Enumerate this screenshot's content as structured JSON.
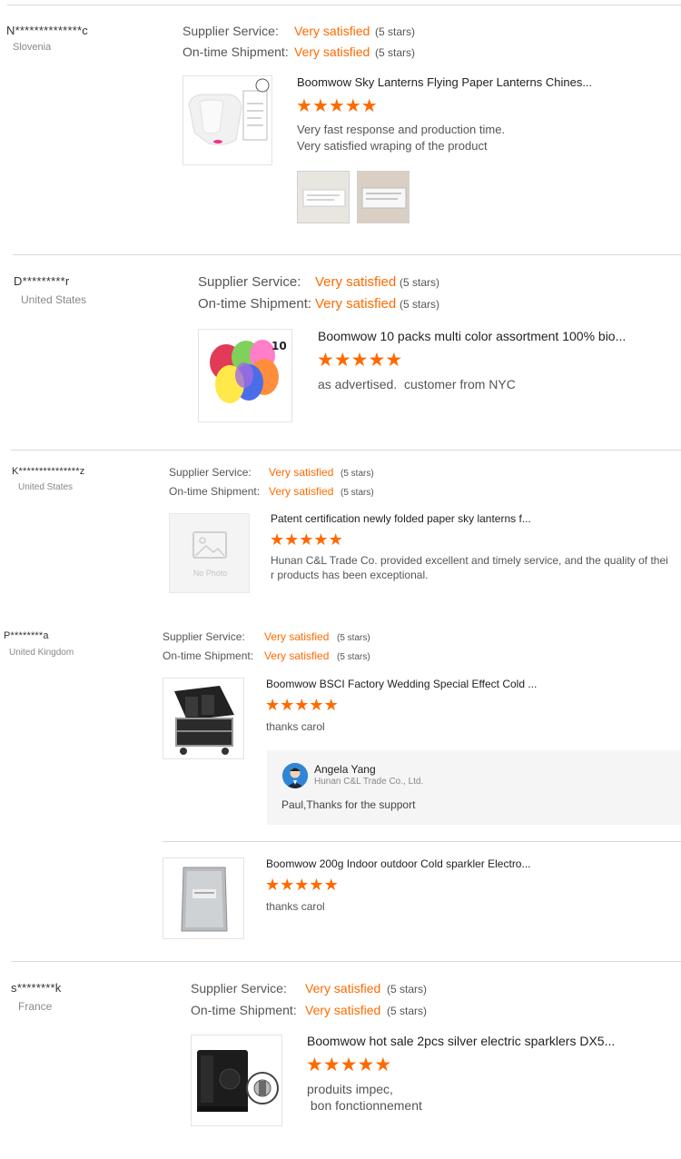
{
  "labels": {
    "supplier_service": "Supplier Service:",
    "ontime_shipment": "On-time Shipment:"
  },
  "colors": {
    "accent": "#ff6a00",
    "divider": "#d9d9d9",
    "reply_bg": "#f5f5f5"
  },
  "reviews": [
    {
      "buyer": "N**************c",
      "country": "Slovenia",
      "supplier_service": {
        "value": "Very satisfied",
        "stars": "(5 stars)"
      },
      "ontime_shipment": {
        "value": "Very satisfied",
        "stars": "(5 stars)"
      },
      "products": [
        {
          "title": "Boomwow Sky Lanterns Flying Paper Lanterns Chines...",
          "rating": 5,
          "comment": [
            "Very fast response and production time.",
            "Very satisfied wraping of the product"
          ],
          "image_icon": "white-sky-lanterns-photo"
        }
      ]
    },
    {
      "buyer": "D*********r",
      "country": "United States",
      "supplier_service": {
        "value": "Very satisfied",
        "stars": "(5 stars)"
      },
      "ontime_shipment": {
        "value": "Very satisfied",
        "stars": "(5 stars)"
      },
      "products": [
        {
          "title": "Boomwow 10 packs multi color assortment 100% bio...",
          "rating": 5,
          "comment": [
            "as advertised.  customer from NYC"
          ],
          "image_icon": "color-lanterns-photo",
          "image_badge": "10"
        }
      ]
    },
    {
      "buyer": "K***************z",
      "country": "United States",
      "supplier_service": {
        "value": "Very satisfied",
        "stars": "(5 stars)"
      },
      "ontime_shipment": {
        "value": "Very satisfied",
        "stars": "(5 stars)"
      },
      "products": [
        {
          "title": "Patent certification newly folded paper sky lanterns f...",
          "rating": 5,
          "comment": [
            "Hunan C&L Trade Co. provided excellent and timely service, and the quality of thei",
            "r products has been exceptional."
          ],
          "image_icon": "no-photo-placeholder",
          "image_text": "No Photo"
        }
      ]
    },
    {
      "buyer": "P********a",
      "country": "United Kingdom",
      "supplier_service": {
        "value": "Very satisfied",
        "stars": "(5 stars)"
      },
      "ontime_shipment": {
        "value": "Very satisfied",
        "stars": "(5 stars)"
      },
      "products": [
        {
          "title": "Boomwow BSCI Factory Wedding Special Effect Cold ...",
          "rating": 5,
          "comment": [
            "thanks carol"
          ],
          "image_icon": "flight-case-machine-photo",
          "reply": {
            "name": "Angela Yang",
            "company": "Hunan C&L Trade Co., Ltd.",
            "text": "Paul,Thanks for the support"
          }
        },
        {
          "title": "Boomwow 200g Indoor outdoor Cold sparkler Electro...",
          "rating": 5,
          "comment": [
            "thanks carol"
          ],
          "image_icon": "powder-bag-photo"
        }
      ]
    },
    {
      "buyer": "s********k",
      "country": "France",
      "supplier_service": {
        "value": "Very satisfied",
        "stars": "(5 stars)"
      },
      "ontime_shipment": {
        "value": "Very satisfied",
        "stars": "(5 stars)"
      },
      "products": [
        {
          "title": "Boomwow hot sale 2pcs silver electric sparklers DX5...",
          "rating": 5,
          "comment": [
            "produits impec,",
            " bon fonctionnement"
          ],
          "image_icon": "sparkler-machine-photo"
        }
      ]
    }
  ]
}
